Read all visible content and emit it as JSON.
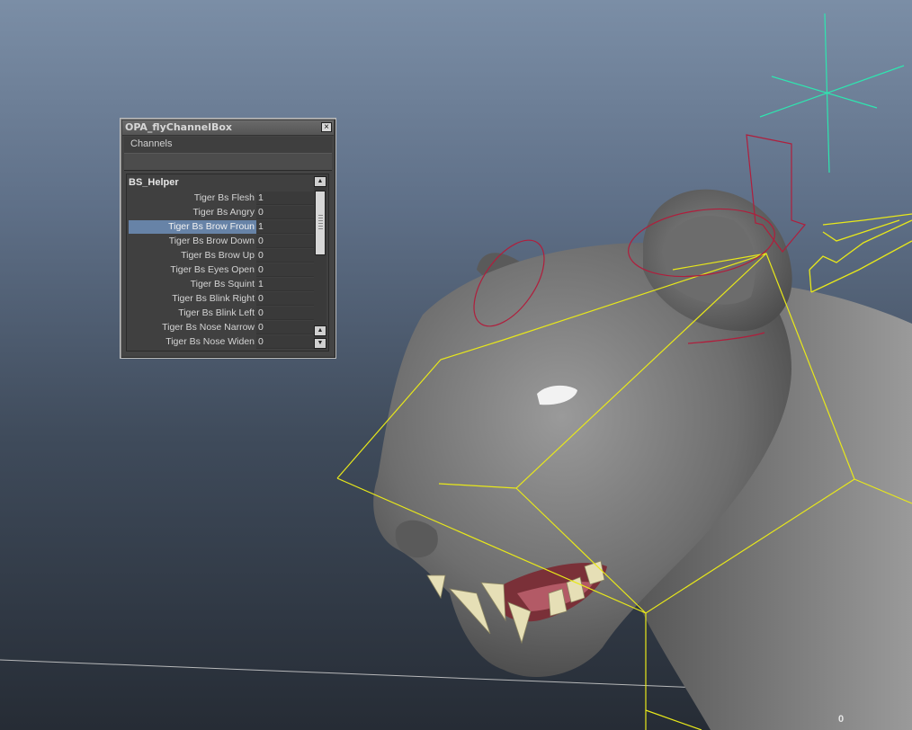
{
  "window": {
    "title": "OPA_flyChannelBox",
    "close_label": "×",
    "menu": [
      "Channels"
    ],
    "node_name": "BS_Helper"
  },
  "channels": [
    {
      "label": "Tiger Bs Flesh",
      "value": "1"
    },
    {
      "label": "Tiger Bs Angry",
      "value": "0"
    },
    {
      "label": "Tiger Bs Brow Froun",
      "value": "1",
      "selected": true
    },
    {
      "label": "Tiger Bs Brow Down",
      "value": "0"
    },
    {
      "label": "Tiger Bs Brow Up",
      "value": "0"
    },
    {
      "label": "Tiger Bs Eyes Open",
      "value": "0"
    },
    {
      "label": "Tiger Bs Squint",
      "value": "1"
    },
    {
      "label": "Tiger Bs Blink Right",
      "value": "0"
    },
    {
      "label": "Tiger Bs Blink Left",
      "value": "0"
    },
    {
      "label": "Tiger Bs Nose Narrow",
      "value": "0"
    },
    {
      "label": "Tiger Bs Nose Widen",
      "value": "0"
    }
  ],
  "scrollbar": {
    "up_icon": "triangle-up",
    "down_icon": "triangle-down"
  },
  "hud": {
    "frame_value": "0"
  },
  "colors": {
    "selection": "#6783a7",
    "rig_yellow": "#e8e81a",
    "control_red": "#b01e3c",
    "locator_green": "#2ee6b0"
  }
}
